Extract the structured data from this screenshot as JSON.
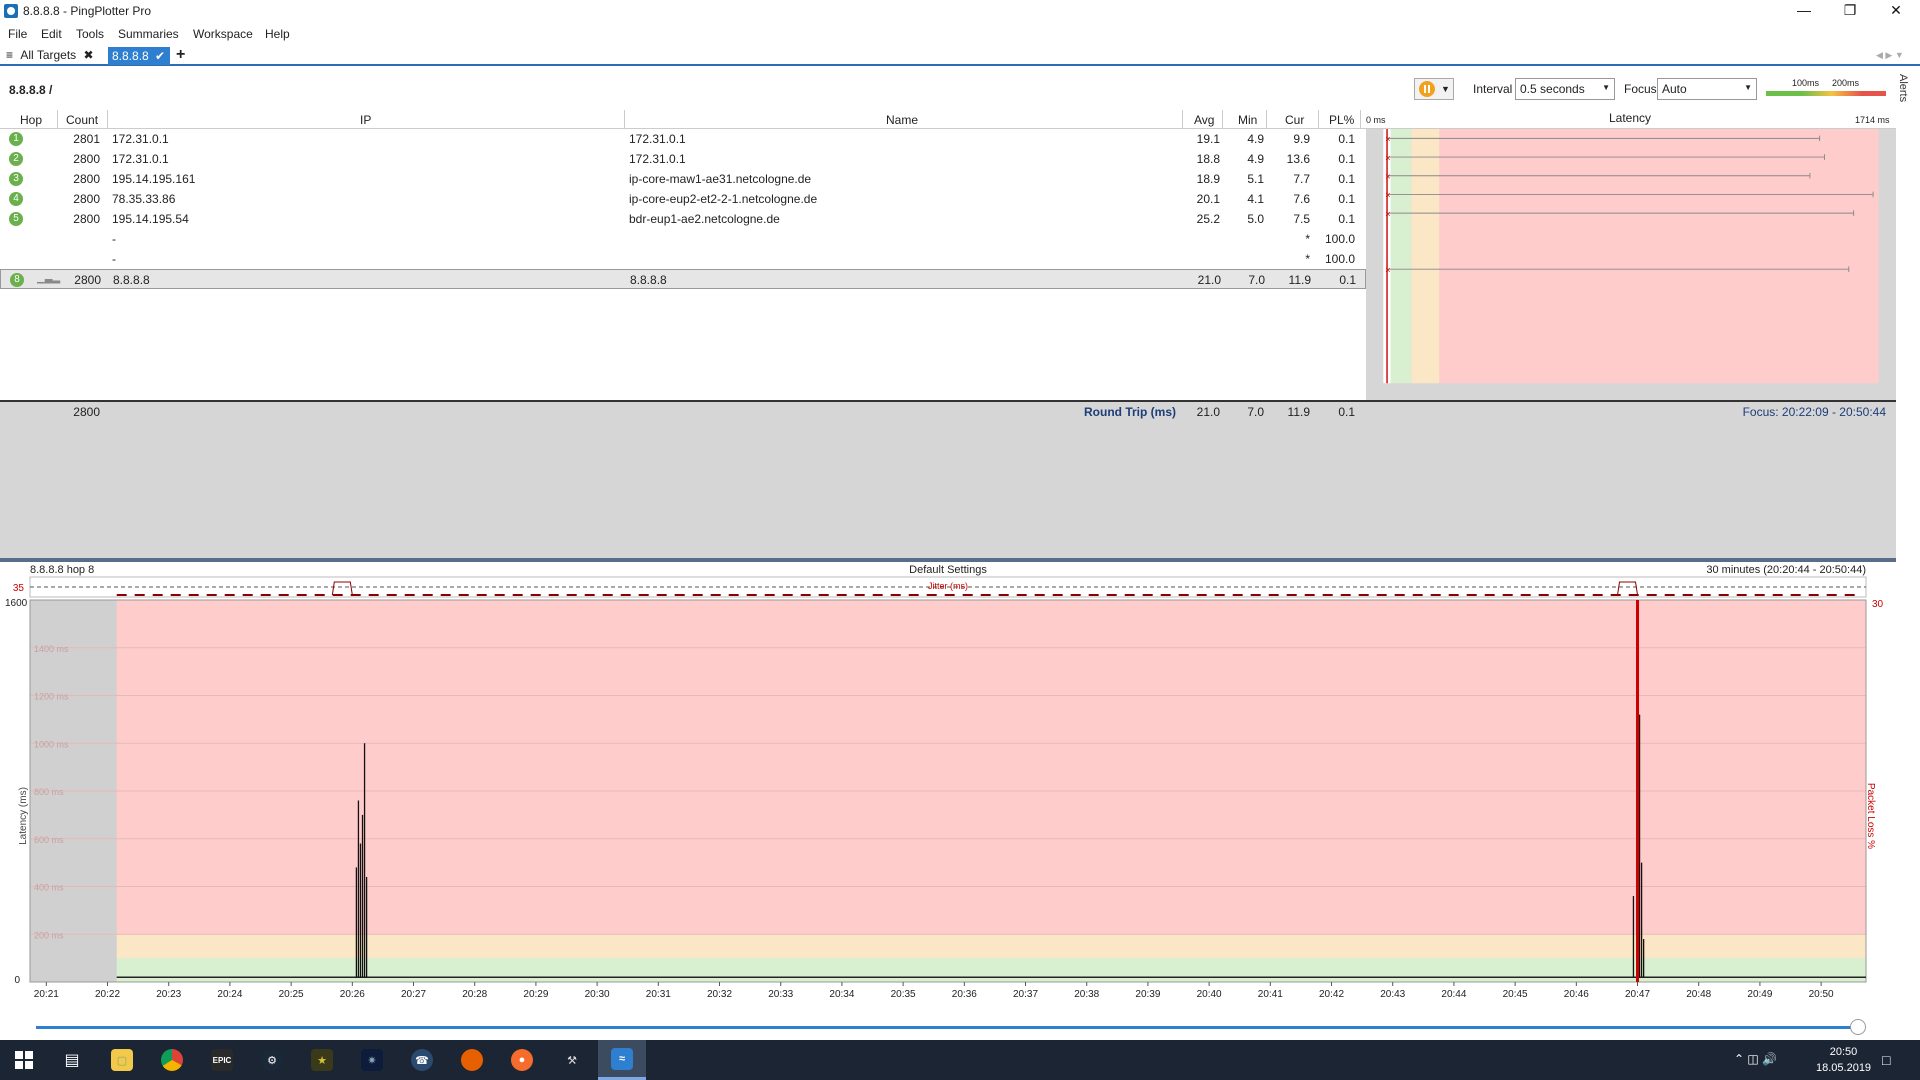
{
  "window": {
    "title": "8.8.8.8 - PingPlotter Pro"
  },
  "menu": [
    "File",
    "Edit",
    "Tools",
    "Summaries",
    "Workspace",
    "Help"
  ],
  "tabs": {
    "all_targets": "All Targets",
    "active": "8.8.8.8"
  },
  "toolbar": {
    "breadcrumb": "8.8.8.8 /",
    "interval_label": "Interval",
    "interval_value": "0.5 seconds",
    "focus_label": "Focus",
    "focus_value": "Auto",
    "scale_100": "100ms",
    "scale_200": "200ms",
    "alerts": "Alerts"
  },
  "table": {
    "headers": {
      "hop": "Hop",
      "count": "Count",
      "ip": "IP",
      "name": "Name",
      "avg": "Avg",
      "min": "Min",
      "cur": "Cur",
      "pl": "PL%",
      "latency": "Latency",
      "lat_min": "0 ms",
      "lat_max": "1714 ms"
    },
    "rows": [
      {
        "hop": "1",
        "count": "2801",
        "ip": "172.31.0.1",
        "name": "172.31.0.1",
        "avg": "19.1",
        "min": "4.9",
        "cur": "9.9",
        "pl": "0.1",
        "maxfrac": 0.89
      },
      {
        "hop": "2",
        "count": "2800",
        "ip": "172.31.0.1",
        "name": "172.31.0.1",
        "avg": "18.8",
        "min": "4.9",
        "cur": "13.6",
        "pl": "0.1",
        "maxfrac": 0.9
      },
      {
        "hop": "3",
        "count": "2800",
        "ip": "195.14.195.161",
        "name": "ip-core-maw1-ae31.netcologne.de",
        "avg": "18.9",
        "min": "5.1",
        "cur": "7.7",
        "pl": "0.1",
        "maxfrac": 0.87
      },
      {
        "hop": "4",
        "count": "2800",
        "ip": "78.35.33.86",
        "name": "ip-core-eup2-et2-2-1.netcologne.de",
        "avg": "20.1",
        "min": "4.1",
        "cur": "7.6",
        "pl": "0.1",
        "maxfrac": 1.0
      },
      {
        "hop": "5",
        "count": "2800",
        "ip": "195.14.195.54",
        "name": "bdr-eup1-ae2.netcologne.de",
        "avg": "25.2",
        "min": "5.0",
        "cur": "7.5",
        "pl": "0.1",
        "maxfrac": 0.96
      },
      {
        "hop": "",
        "count": "",
        "ip": "-",
        "name": "",
        "avg": "",
        "min": "",
        "cur": "*",
        "pl": "100.0",
        "maxfrac": 0
      },
      {
        "hop": "",
        "count": "",
        "ip": "-",
        "name": "",
        "avg": "",
        "min": "",
        "cur": "*",
        "pl": "100.0",
        "maxfrac": 0
      },
      {
        "hop": "8",
        "count": "2800",
        "ip": "8.8.8.8",
        "name": "8.8.8.8",
        "avg": "21.0",
        "min": "7.0",
        "cur": "11.9",
        "pl": "0.1",
        "maxfrac": 0.95
      }
    ],
    "round_trip": {
      "count": "2800",
      "label": "Round Trip (ms)",
      "avg": "21.0",
      "min": "7.0",
      "cur": "11.9",
      "pl": "0.1",
      "focus": "Focus: 20:22:09 - 20:50:44"
    }
  },
  "chart": {
    "left_title": "8.8.8.8 hop 8",
    "center_title": "Default Settings",
    "right_title": "30 minutes (20:20:44 - 20:50:44)",
    "jitter_label": "Jitter (ms)",
    "jitter_max": "35",
    "y_top": "1600",
    "y_zero": "0",
    "pl_top": "30",
    "ylabel": "Latency (ms)",
    "y2label": "Packet Loss %",
    "y_ticks": [
      "1400 ms",
      "1200 ms",
      "1000 ms",
      "800 ms",
      "600 ms",
      "400 ms",
      "200 ms"
    ],
    "x_ticks": [
      "20:21",
      "20:22",
      "20:23",
      "20:24",
      "20:25",
      "20:26",
      "20:27",
      "20:28",
      "20:29",
      "20:30",
      "20:31",
      "20:32",
      "20:33",
      "20:34",
      "20:35",
      "20:36",
      "20:37",
      "20:38",
      "20:39",
      "20:40",
      "20:41",
      "20:42",
      "20:43",
      "20:44",
      "20:45",
      "20:46",
      "20:47",
      "20:48",
      "20:49",
      "20:50"
    ]
  },
  "chart_data": {
    "type": "line",
    "title": "Default Settings",
    "xlabel": "",
    "ylabel": "Latency (ms)",
    "ylim": [
      0,
      1600
    ],
    "y2label": "Packet Loss %",
    "y2lim": [
      0,
      30
    ],
    "series": [
      {
        "x": [
          "20:26:00",
          "20:26:04",
          "20:26:06",
          "20:26:08",
          "20:26:10",
          "20:26:12",
          "20:26:14",
          "20:26:16",
          "20:46:52",
          "20:46:56",
          "20:47:00",
          "20:47:02",
          "20:47:04",
          "20:47:06",
          "20:47:08"
        ],
        "values": [
          20,
          480,
          760,
          580,
          700,
          1000,
          440,
          20,
          20,
          360,
          1600,
          1120,
          500,
          180,
          20
        ]
      }
    ],
    "baseline_ms": 20,
    "packet_loss_spike": {
      "x": "20:47:00",
      "value": 30
    }
  },
  "taskbar": {
    "time": "20:50",
    "date": "18.05.2019",
    "icons": [
      "windows-icon",
      "task-view-icon",
      "explorer-icon",
      "chrome-icon",
      "epic-icon",
      "steam-icon",
      "app-icon",
      "app2-icon",
      "teamspeak-icon",
      "firefox-icon",
      "origin-icon",
      "tool-icon",
      "pingplotter-icon"
    ]
  }
}
